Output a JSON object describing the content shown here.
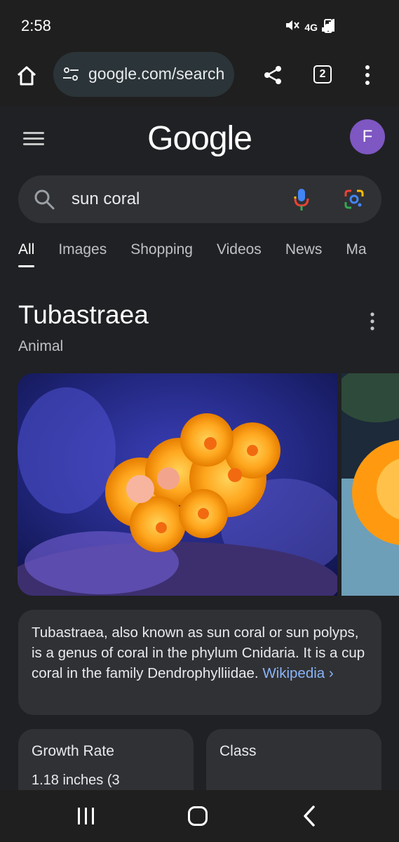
{
  "status": {
    "time": "2:58",
    "network": "4G"
  },
  "browser": {
    "url": "google.com/search",
    "tab_count": "2"
  },
  "google": {
    "logo": "Google",
    "avatar_letter": "F",
    "avatar_color": "#7e57c2"
  },
  "search": {
    "query": "sun coral"
  },
  "tabs": [
    {
      "label": "All",
      "active": true
    },
    {
      "label": "Images"
    },
    {
      "label": "Shopping"
    },
    {
      "label": "Videos"
    },
    {
      "label": "News"
    },
    {
      "label": "Ma"
    }
  ],
  "knowledge_panel": {
    "title": "Tubastraea",
    "subtitle": "Animal",
    "description": "Tubastraea, also known as sun coral or sun polyps, is a genus of coral in the phylum Cnidaria. It is a cup coral in the family Dendrophylliidae.",
    "source_link": "Wikipedia",
    "source_chevron": "›",
    "facts": [
      {
        "label": "Growth Rate",
        "value": "1.18 inches (3"
      },
      {
        "label": "Class",
        "value": ""
      }
    ]
  },
  "colors": {
    "link": "#8ab4f8",
    "background": "#202124",
    "card": "#303134"
  }
}
